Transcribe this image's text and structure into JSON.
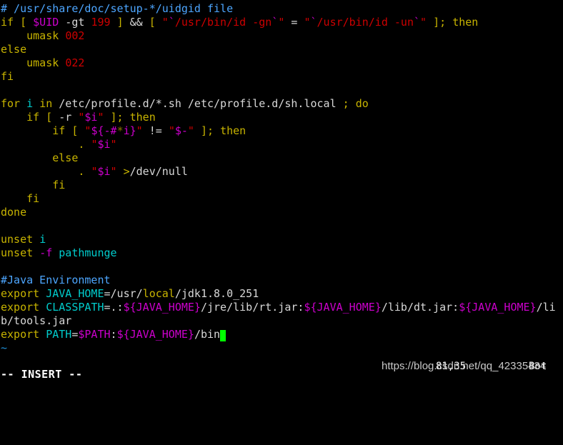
{
  "editor": {
    "name": "vim",
    "mode_text": "-- INSERT --",
    "cursor_ruler": "81,35",
    "scroll_state": "Bot",
    "empty_line_marker": "~",
    "colors": {
      "background": "#000000",
      "comment": "#4da6ff",
      "statement": "#c8b400",
      "identifier": "#00cdcd",
      "constant": "#cd0000",
      "string": "#cd0000",
      "preproc_variable": "#cd00cd",
      "normal_text": "#d8d8d8",
      "cursor": "#00ff00",
      "tilde": "#1e90d8",
      "status_text": "#ffffff"
    }
  },
  "watermark": {
    "text": "https://blog.csdn.net/qq_42335434"
  },
  "lines": [
    {
      "id": 1,
      "text": "# /usr/share/doc/setup-*/uidgid file",
      "spans": [
        {
          "t": "# /usr/share/doc/setup-*/uidgid file",
          "c": "c-comment"
        }
      ]
    },
    {
      "id": 2,
      "text": "if [ $UID -gt 199 ] && [ \"`/usr/bin/id -gn`\" = \"`/usr/bin/id -un`\" ]; then",
      "spans": [
        {
          "t": "if",
          "c": "c-stmt"
        },
        {
          "t": " ",
          "c": "c-norm"
        },
        {
          "t": "[",
          "c": "c-stmt"
        },
        {
          "t": " ",
          "c": "c-norm"
        },
        {
          "t": "$UID",
          "c": "c-pre"
        },
        {
          "t": " -gt ",
          "c": "c-norm"
        },
        {
          "t": "199",
          "c": "c-const"
        },
        {
          "t": " ",
          "c": "c-norm"
        },
        {
          "t": "]",
          "c": "c-stmt"
        },
        {
          "t": " ",
          "c": "c-norm"
        },
        {
          "t": "&&",
          "c": "c-norm"
        },
        {
          "t": " ",
          "c": "c-norm"
        },
        {
          "t": "[",
          "c": "c-stmt"
        },
        {
          "t": " ",
          "c": "c-norm"
        },
        {
          "t": "\"",
          "c": "c-str"
        },
        {
          "t": "`",
          "c": "c-pre"
        },
        {
          "t": "/usr/bin/id -gn",
          "c": "c-str"
        },
        {
          "t": "`",
          "c": "c-pre"
        },
        {
          "t": "\"",
          "c": "c-str"
        },
        {
          "t": " = ",
          "c": "c-norm"
        },
        {
          "t": "\"",
          "c": "c-str"
        },
        {
          "t": "`",
          "c": "c-pre"
        },
        {
          "t": "/usr/bin/id -un",
          "c": "c-str"
        },
        {
          "t": "`",
          "c": "c-pre"
        },
        {
          "t": "\"",
          "c": "c-str"
        },
        {
          "t": " ",
          "c": "c-norm"
        },
        {
          "t": "];",
          "c": "c-stmt"
        },
        {
          "t": " ",
          "c": "c-norm"
        },
        {
          "t": "then",
          "c": "c-stmt"
        }
      ]
    },
    {
      "id": 3,
      "text": "    umask 002",
      "spans": [
        {
          "t": "    ",
          "c": "c-norm"
        },
        {
          "t": "umask",
          "c": "c-stmt"
        },
        {
          "t": " ",
          "c": "c-norm"
        },
        {
          "t": "002",
          "c": "c-const"
        }
      ]
    },
    {
      "id": 4,
      "text": "else",
      "spans": [
        {
          "t": "else",
          "c": "c-stmt"
        }
      ]
    },
    {
      "id": 5,
      "text": "    umask 022",
      "spans": [
        {
          "t": "    ",
          "c": "c-norm"
        },
        {
          "t": "umask",
          "c": "c-stmt"
        },
        {
          "t": " ",
          "c": "c-norm"
        },
        {
          "t": "022",
          "c": "c-const"
        }
      ]
    },
    {
      "id": 6,
      "text": "fi",
      "spans": [
        {
          "t": "fi",
          "c": "c-stmt"
        }
      ]
    },
    {
      "id": 7,
      "text": "",
      "spans": []
    },
    {
      "id": 8,
      "text": "for i in /etc/profile.d/*.sh /etc/profile.d/sh.local ; do",
      "spans": [
        {
          "t": "for",
          "c": "c-stmt"
        },
        {
          "t": " ",
          "c": "c-norm"
        },
        {
          "t": "i",
          "c": "c-ident"
        },
        {
          "t": " ",
          "c": "c-norm"
        },
        {
          "t": "in",
          "c": "c-stmt"
        },
        {
          "t": " /etc/profile.d/*.sh /etc/profile.d/sh.local ",
          "c": "c-norm"
        },
        {
          "t": ";",
          "c": "c-stmt"
        },
        {
          "t": " ",
          "c": "c-norm"
        },
        {
          "t": "do",
          "c": "c-stmt"
        }
      ]
    },
    {
      "id": 9,
      "text": "    if [ -r \"$i\" ]; then",
      "spans": [
        {
          "t": "    ",
          "c": "c-norm"
        },
        {
          "t": "if",
          "c": "c-stmt"
        },
        {
          "t": " ",
          "c": "c-norm"
        },
        {
          "t": "[",
          "c": "c-stmt"
        },
        {
          "t": " -r ",
          "c": "c-norm"
        },
        {
          "t": "\"",
          "c": "c-str"
        },
        {
          "t": "$i",
          "c": "c-pre"
        },
        {
          "t": "\"",
          "c": "c-str"
        },
        {
          "t": " ",
          "c": "c-norm"
        },
        {
          "t": "];",
          "c": "c-stmt"
        },
        {
          "t": " ",
          "c": "c-norm"
        },
        {
          "t": "then",
          "c": "c-stmt"
        }
      ]
    },
    {
      "id": 10,
      "text": "        if [ \"${-#*i}\" != \"$-\" ]; then",
      "spans": [
        {
          "t": "        ",
          "c": "c-norm"
        },
        {
          "t": "if",
          "c": "c-stmt"
        },
        {
          "t": " ",
          "c": "c-norm"
        },
        {
          "t": "[",
          "c": "c-stmt"
        },
        {
          "t": " ",
          "c": "c-norm"
        },
        {
          "t": "\"",
          "c": "c-str"
        },
        {
          "t": "${-#",
          "c": "c-pre"
        },
        {
          "t": "*",
          "c": "c-dim"
        },
        {
          "t": "i}",
          "c": "c-pre"
        },
        {
          "t": "\"",
          "c": "c-str"
        },
        {
          "t": " != ",
          "c": "c-norm"
        },
        {
          "t": "\"",
          "c": "c-str"
        },
        {
          "t": "$-",
          "c": "c-pre"
        },
        {
          "t": "\"",
          "c": "c-str"
        },
        {
          "t": " ",
          "c": "c-norm"
        },
        {
          "t": "];",
          "c": "c-stmt"
        },
        {
          "t": " ",
          "c": "c-norm"
        },
        {
          "t": "then",
          "c": "c-stmt"
        }
      ]
    },
    {
      "id": 11,
      "text": "            . \"$i\"",
      "spans": [
        {
          "t": "            ",
          "c": "c-norm"
        },
        {
          "t": ".",
          "c": "c-stmt"
        },
        {
          "t": " ",
          "c": "c-norm"
        },
        {
          "t": "\"",
          "c": "c-str"
        },
        {
          "t": "$i",
          "c": "c-pre"
        },
        {
          "t": "\"",
          "c": "c-str"
        }
      ]
    },
    {
      "id": 12,
      "text": "        else",
      "spans": [
        {
          "t": "        ",
          "c": "c-norm"
        },
        {
          "t": "else",
          "c": "c-stmt"
        }
      ]
    },
    {
      "id": 13,
      "text": "            . \"$i\" >/dev/null",
      "spans": [
        {
          "t": "            ",
          "c": "c-norm"
        },
        {
          "t": ".",
          "c": "c-stmt"
        },
        {
          "t": " ",
          "c": "c-norm"
        },
        {
          "t": "\"",
          "c": "c-str"
        },
        {
          "t": "$i",
          "c": "c-pre"
        },
        {
          "t": "\"",
          "c": "c-str"
        },
        {
          "t": " ",
          "c": "c-norm"
        },
        {
          "t": ">",
          "c": "c-oper"
        },
        {
          "t": "/dev/null",
          "c": "c-norm"
        }
      ]
    },
    {
      "id": 14,
      "text": "        fi",
      "spans": [
        {
          "t": "        ",
          "c": "c-norm"
        },
        {
          "t": "fi",
          "c": "c-stmt"
        }
      ]
    },
    {
      "id": 15,
      "text": "    fi",
      "spans": [
        {
          "t": "    ",
          "c": "c-norm"
        },
        {
          "t": "fi",
          "c": "c-stmt"
        }
      ]
    },
    {
      "id": 16,
      "text": "done",
      "spans": [
        {
          "t": "done",
          "c": "c-stmt"
        }
      ]
    },
    {
      "id": 17,
      "text": "",
      "spans": []
    },
    {
      "id": 18,
      "text": "unset i",
      "spans": [
        {
          "t": "unset",
          "c": "c-stmt"
        },
        {
          "t": " ",
          "c": "c-norm"
        },
        {
          "t": "i",
          "c": "c-ident"
        }
      ]
    },
    {
      "id": 19,
      "text": "unset -f pathmunge",
      "spans": [
        {
          "t": "unset",
          "c": "c-stmt"
        },
        {
          "t": " ",
          "c": "c-norm"
        },
        {
          "t": "-f",
          "c": "c-pre"
        },
        {
          "t": " ",
          "c": "c-norm"
        },
        {
          "t": "pathmunge",
          "c": "c-ident"
        }
      ]
    },
    {
      "id": 20,
      "text": "",
      "spans": []
    },
    {
      "id": 21,
      "text": "#Java Environment",
      "spans": [
        {
          "t": "#Java Environment",
          "c": "c-comment"
        }
      ]
    },
    {
      "id": 22,
      "text": "export JAVA_HOME=/usr/local/jdk1.8.0_251",
      "spans": [
        {
          "t": "export",
          "c": "c-stmt"
        },
        {
          "t": " ",
          "c": "c-norm"
        },
        {
          "t": "JAVA_HOME",
          "c": "c-ident"
        },
        {
          "t": "=/usr/",
          "c": "c-norm"
        },
        {
          "t": "local",
          "c": "c-stmt"
        },
        {
          "t": "/jdk1.8.0_251",
          "c": "c-norm"
        }
      ]
    },
    {
      "id": 23,
      "text": "export CLASSPATH=.:${JAVA_HOME}/jre/lib/rt.jar:${JAVA_HOME}/lib/dt.jar:${JAVA_HOME}/li",
      "spans": [
        {
          "t": "export",
          "c": "c-stmt"
        },
        {
          "t": " ",
          "c": "c-norm"
        },
        {
          "t": "CLASSPATH",
          "c": "c-ident"
        },
        {
          "t": "=.:",
          "c": "c-norm"
        },
        {
          "t": "${JAVA_HOME}",
          "c": "c-pre"
        },
        {
          "t": "/jre/lib/rt.jar:",
          "c": "c-norm"
        },
        {
          "t": "${JAVA_HOME}",
          "c": "c-pre"
        },
        {
          "t": "/lib/dt.jar:",
          "c": "c-norm"
        },
        {
          "t": "${JAVA_HOME}",
          "c": "c-pre"
        },
        {
          "t": "/li",
          "c": "c-norm"
        }
      ]
    },
    {
      "id": 24,
      "text": "b/tools.jar",
      "spans": [
        {
          "t": "b/tools.jar",
          "c": "c-norm"
        }
      ]
    },
    {
      "id": 25,
      "text": "export PATH=$PATH:${JAVA_HOME}/bin",
      "spans": [
        {
          "t": "export",
          "c": "c-stmt"
        },
        {
          "t": " ",
          "c": "c-norm"
        },
        {
          "t": "PATH",
          "c": "c-ident"
        },
        {
          "t": "=",
          "c": "c-norm"
        },
        {
          "t": "$PATH",
          "c": "c-pre"
        },
        {
          "t": ":",
          "c": "c-norm"
        },
        {
          "t": "${JAVA_HOME}",
          "c": "c-pre"
        },
        {
          "t": "/bin",
          "c": "c-norm"
        }
      ],
      "cursor_after": true
    },
    {
      "id": 26,
      "text": "~",
      "spans": [
        {
          "t": "~",
          "c": "c-tilde"
        }
      ]
    }
  ]
}
